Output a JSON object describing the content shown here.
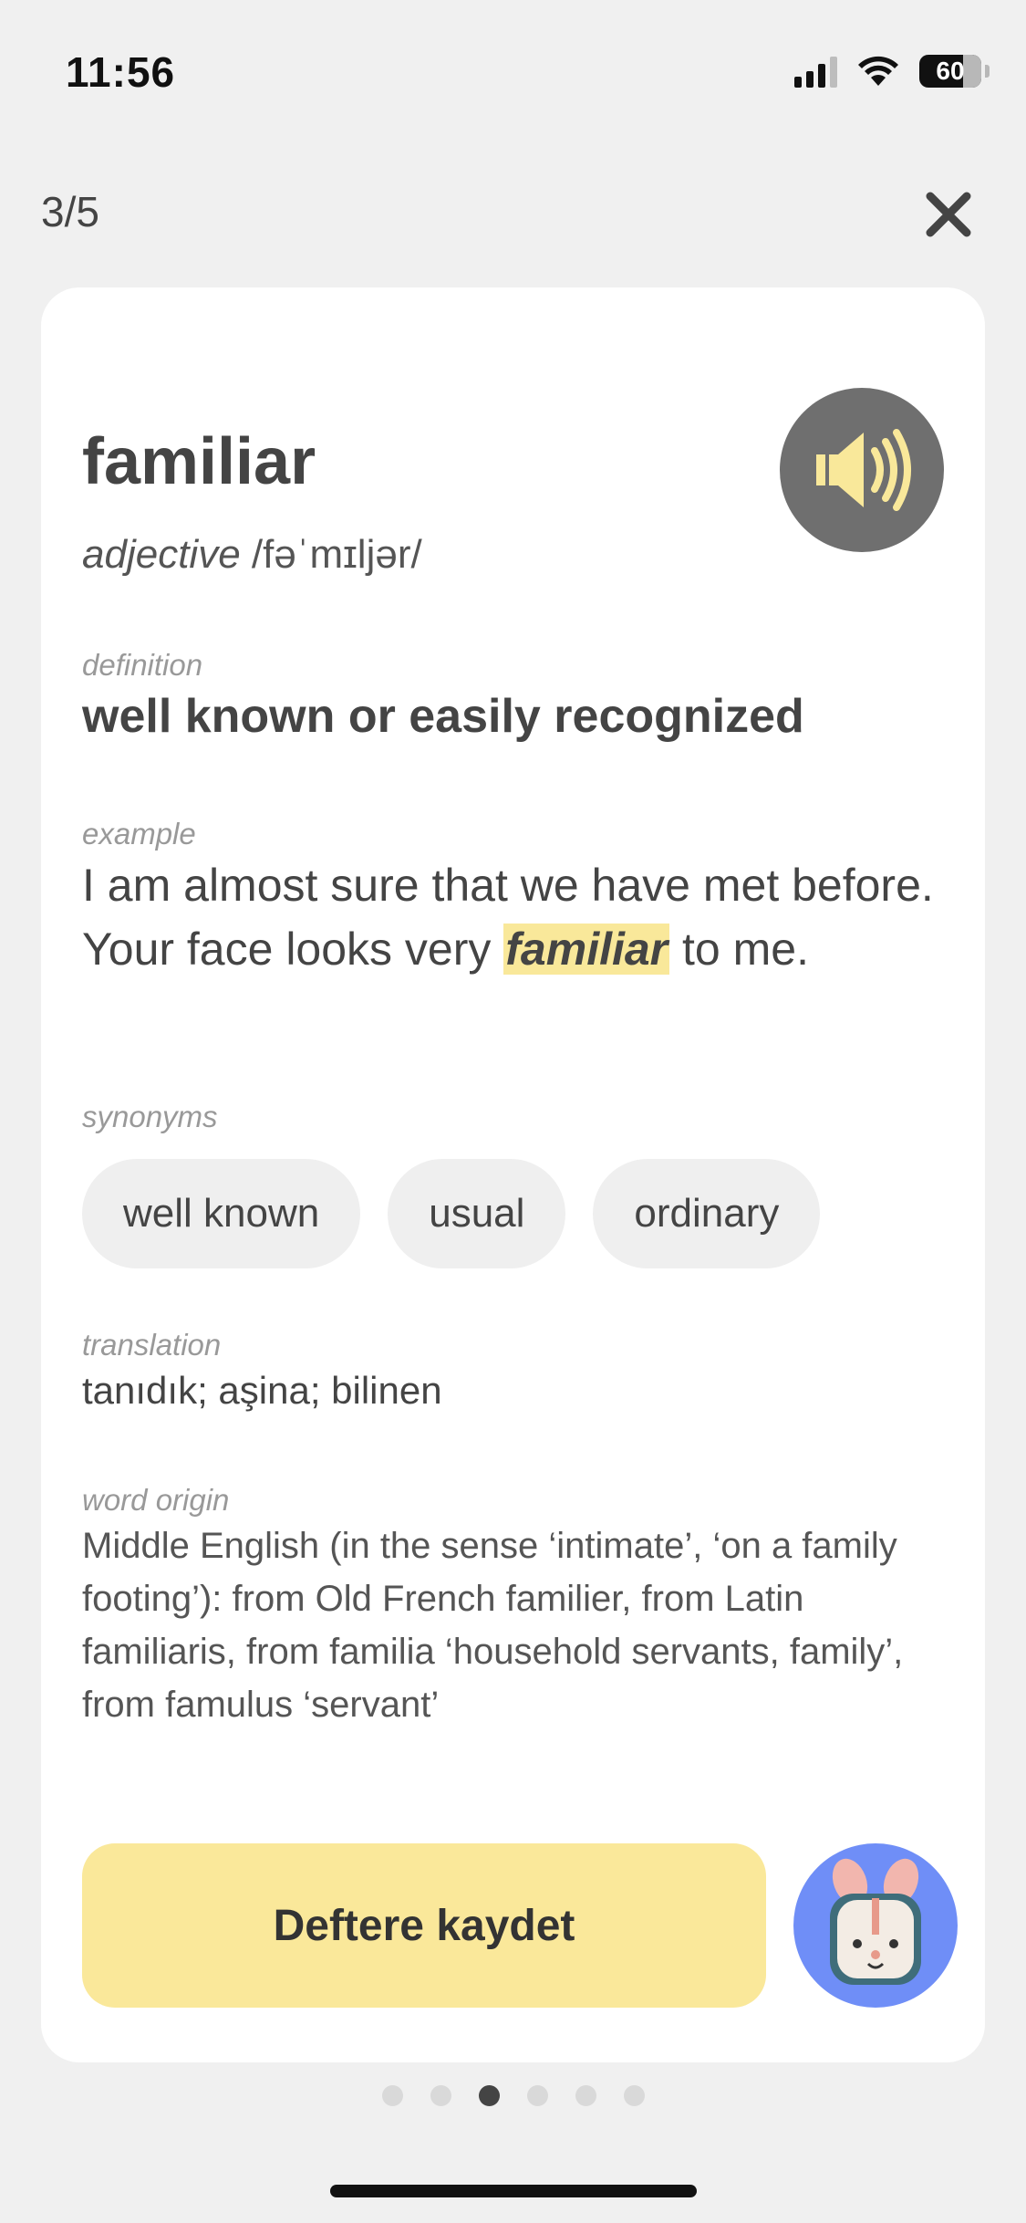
{
  "status_bar": {
    "time": "11:56",
    "battery": "60"
  },
  "header": {
    "progress": "3/5"
  },
  "card": {
    "word": "familiar",
    "part_of_speech": "adjective",
    "pronunciation": "/fəˈmɪljər/",
    "definition_label": "definition",
    "definition": "well known or easily recognized",
    "example_label": "example",
    "example_before": "I am almost sure that we have met before. Your face looks very ",
    "example_highlight": "familiar",
    "example_after": " to me.",
    "synonyms_label": "synonyms",
    "synonyms": [
      "well known",
      "usual",
      "ordinary"
    ],
    "translation_label": "translation",
    "translation": "tanıdık; aşina; bilinen",
    "origin_label": "word origin",
    "origin": "Middle English (in the sense ‘intimate’, ‘on a family footing’): from Old French familier, from Latin familiaris, from familia ‘household servants, family’, from famulus ‘servant’",
    "save_button": "Deftere kaydet"
  },
  "pagination": {
    "total": 6,
    "current": 3
  },
  "colors": {
    "background": "#f0f0f0",
    "card": "#ffffff",
    "highlight": "#f9e89a",
    "save_button": "#fae89a",
    "speaker_button": "#6f6f6f",
    "mascot_bg": "#6f8ef7"
  },
  "icons": {
    "close": "close-icon",
    "speaker": "speaker-icon",
    "mascot": "bunny-mascot-icon"
  }
}
